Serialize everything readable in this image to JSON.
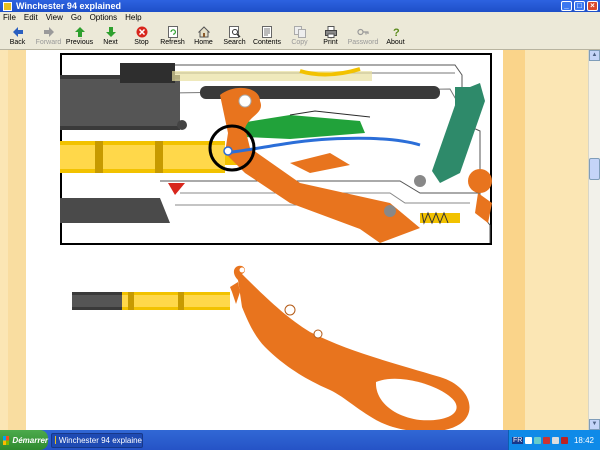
{
  "window": {
    "title": "Winchester 94 explained"
  },
  "menu": [
    "File",
    "Edit",
    "View",
    "Go",
    "Options",
    "Help"
  ],
  "toolbar": {
    "buttons": [
      {
        "label": "Back",
        "icon": "back-arrow-icon",
        "enabled": true
      },
      {
        "label": "Forward",
        "icon": "forward-arrow-icon",
        "enabled": false
      },
      {
        "label": "Previous",
        "icon": "up-arrow-icon",
        "enabled": true
      },
      {
        "label": "Next",
        "icon": "down-arrow-icon",
        "enabled": true
      },
      {
        "label": "Stop",
        "icon": "stop-icon",
        "enabled": true
      },
      {
        "label": "Refresh",
        "icon": "refresh-icon",
        "enabled": true
      },
      {
        "label": "Home",
        "icon": "home-icon",
        "enabled": true
      },
      {
        "label": "Search",
        "icon": "search-icon",
        "enabled": true
      },
      {
        "label": "Contents",
        "icon": "contents-icon",
        "enabled": true
      },
      {
        "label": "Copy",
        "icon": "copy-icon",
        "enabled": false
      },
      {
        "label": "Print",
        "icon": "print-icon",
        "enabled": true
      },
      {
        "label": "Password",
        "icon": "key-icon",
        "enabled": false
      },
      {
        "label": "About",
        "icon": "about-icon",
        "enabled": true
      }
    ]
  },
  "colors": {
    "titlebar": "#1e4fc8",
    "page_margin": "#fbe6b4",
    "lever": "#e8741e",
    "firing_pin": "#f2c200",
    "spring": "#2b6ed8",
    "bolt_dark": "#333333",
    "green_part": "#21a23a",
    "teal_part": "#2e8a6a"
  },
  "taskbar": {
    "start_label": "Démarrer",
    "task_label": "Winchester 94 explaine",
    "tray_lang": "FR",
    "clock": "18:42"
  }
}
